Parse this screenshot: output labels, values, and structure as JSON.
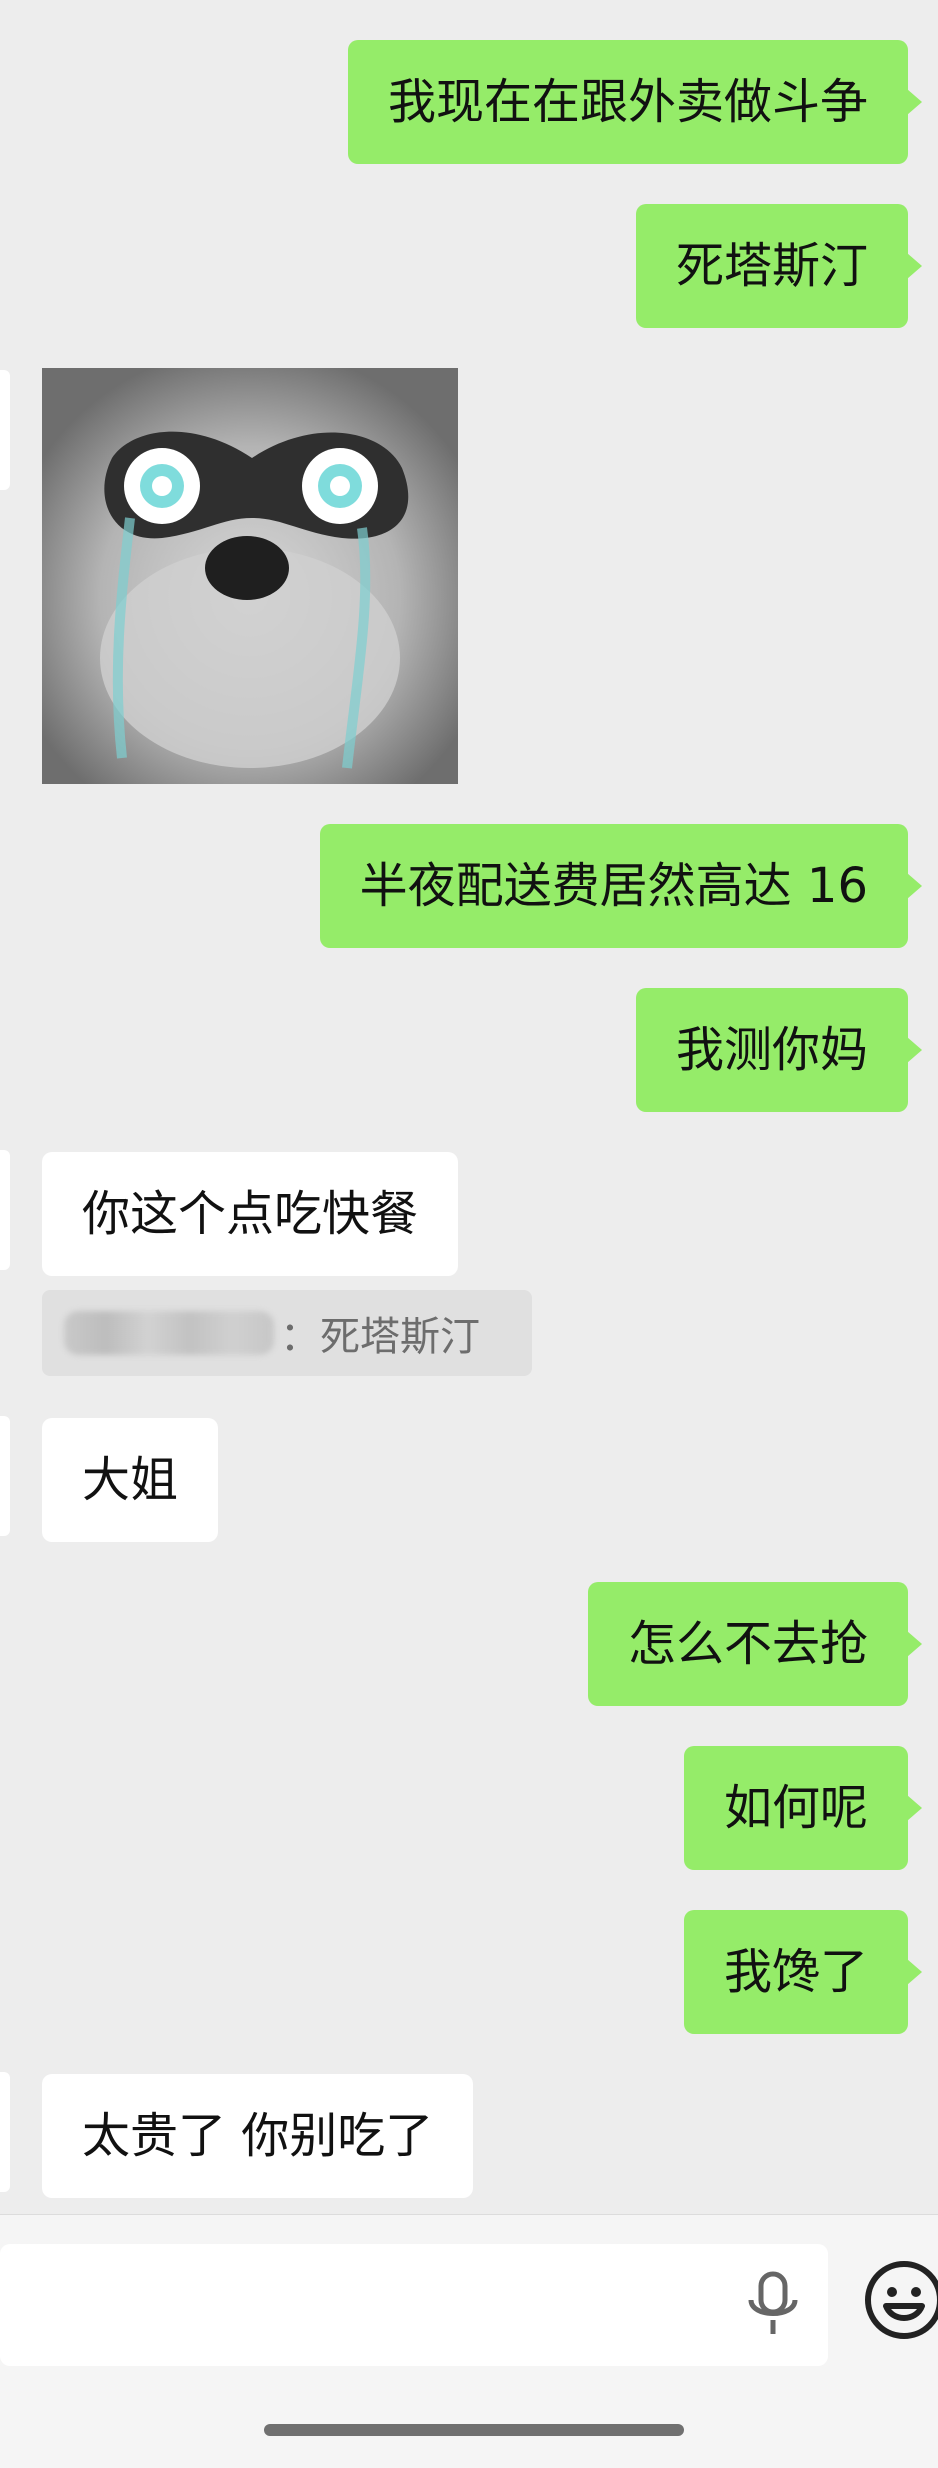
{
  "messages": [
    {
      "side": "sent",
      "text": "我现在在跟外卖做斗争"
    },
    {
      "side": "sent",
      "text": "死塔斯汀"
    },
    {
      "side": "recv",
      "type": "sticker",
      "sticker_name": "crying-masked-dog-sticker"
    },
    {
      "side": "sent",
      "text": "半夜配送费居然高达 16"
    },
    {
      "side": "sent",
      "text": "我测你妈"
    },
    {
      "side": "recv",
      "text": "你这个点吃快餐"
    },
    {
      "side": "recv",
      "type": "quote",
      "quoted_text": "：死塔斯汀"
    },
    {
      "side": "recv",
      "text": "大姐"
    },
    {
      "side": "sent",
      "text": "怎么不去抢"
    },
    {
      "side": "sent",
      "text": "如何呢"
    },
    {
      "side": "sent",
      "text": "我馋了"
    },
    {
      "side": "recv",
      "text": "太贵了 你别吃了"
    }
  ],
  "input_bar": {
    "mic_icon": "microphone-icon",
    "emoji_icon": "emoji-icon"
  },
  "colors": {
    "background": "#ededed",
    "sent_bubble": "#95ec69",
    "received_bubble": "#ffffff",
    "quote_bubble": "#e0e0e0"
  }
}
